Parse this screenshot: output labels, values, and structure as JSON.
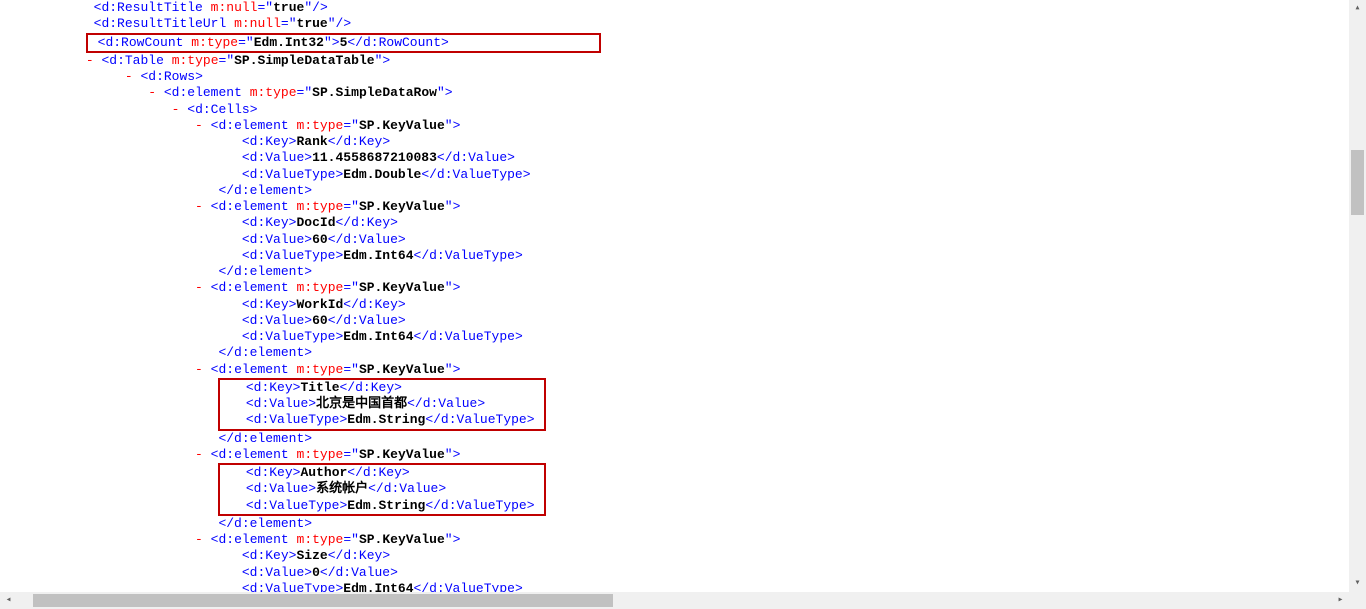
{
  "indent": {
    "i108": "            ",
    "i96": "           ",
    "i128": "                ",
    "i144": "                  ",
    "i156": "                   ",
    "i176": "                      ",
    "i196": "                         ",
    "i216": "                            ",
    "i236": "                               "
  },
  "toggle": "-",
  "lines": {
    "l1": {
      "tag": "d:ResultTitle",
      "attr": "m:null",
      "val": "true"
    },
    "l2": {
      "tag": "d:ResultTitleUrl",
      "attr": "m:null",
      "val": "true"
    },
    "l3": {
      "tag": "d:RowCount",
      "attr": "m:type",
      "val": "Edm.Int32",
      "text": "5"
    },
    "l4": {
      "tag": "d:Table",
      "attr": "m:type",
      "val": "SP.SimpleDataTable"
    },
    "l5": {
      "tag": "d:Rows"
    },
    "l6": {
      "tag": "d:element",
      "attr": "m:type",
      "val": "SP.SimpleDataRow"
    },
    "l7": {
      "tag": "d:Cells"
    },
    "kv1": {
      "keyTag": "d:element",
      "attr": "m:type",
      "val": "SP.KeyValue",
      "key": "Rank",
      "value": "11.4558687210083",
      "type": "Edm.Double"
    },
    "kv2": {
      "keyTag": "d:element",
      "attr": "m:type",
      "val": "SP.KeyValue",
      "key": "DocId",
      "value": "60",
      "type": "Edm.Int64"
    },
    "kv3": {
      "keyTag": "d:element",
      "attr": "m:type",
      "val": "SP.KeyValue",
      "key": "WorkId",
      "value": "60",
      "type": "Edm.Int64"
    },
    "kv4": {
      "keyTag": "d:element",
      "attr": "m:type",
      "val": "SP.KeyValue",
      "key": "Title",
      "value": "北京是中国首都",
      "type": "Edm.String"
    },
    "kv5": {
      "keyTag": "d:element",
      "attr": "m:type",
      "val": "SP.KeyValue",
      "key": "Author",
      "value": "系统帐户",
      "type": "Edm.String"
    },
    "kv6": {
      "keyTag": "d:element",
      "attr": "m:type",
      "val": "SP.KeyValue",
      "key": "Size",
      "value": "0",
      "type": "Edm.Int64"
    },
    "tags": {
      "dKey": "d:Key",
      "dValue": "d:Value",
      "dValueType": "d:ValueType",
      "dElement": "d:element"
    }
  },
  "scroll": {
    "vThumbTop": 150,
    "vThumbHeight": 65,
    "hThumbLeft": 33,
    "hThumbWidth": 580
  },
  "glyphs": {
    "up": "▴",
    "down": "▾",
    "left": "◂",
    "right": "▸"
  }
}
